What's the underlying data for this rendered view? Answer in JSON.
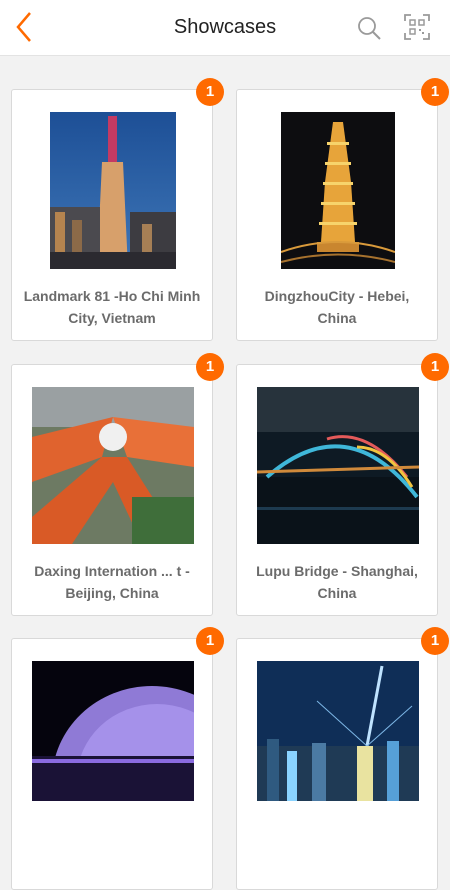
{
  "header": {
    "title": "Showcases",
    "back_icon": "chevron-left-icon",
    "search_icon": "search-icon",
    "scan_icon": "qr-scan-icon",
    "accent_color": "#ff6a00"
  },
  "showcases": [
    {
      "title": "Landmark 81 -Ho Chi Minh City, Vietnam",
      "badge": "1"
    },
    {
      "title": "DingzhouCity - Hebei, China",
      "badge": "1"
    },
    {
      "title": "Daxing Internation ... t - Beijing, China",
      "badge": "1"
    },
    {
      "title": "Lupu Bridge - Shanghai, China",
      "badge": "1"
    },
    {
      "title": "",
      "badge": "1"
    },
    {
      "title": "",
      "badge": "1"
    }
  ]
}
